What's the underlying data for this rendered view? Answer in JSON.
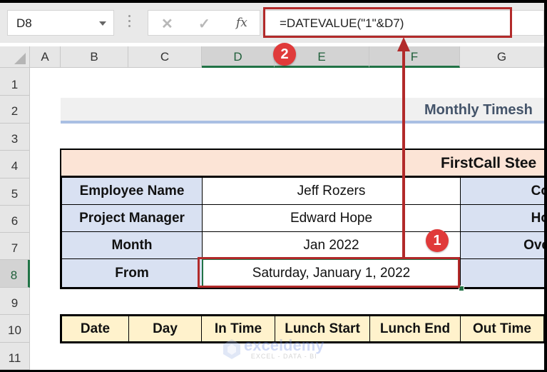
{
  "formula_bar": {
    "name_box": "D8",
    "cancel_icon": "✕",
    "enter_icon": "✓",
    "fx_label": "fx",
    "formula": "=DATEVALUE(\"1\"&D7)"
  },
  "columns": [
    "A",
    "B",
    "C",
    "D",
    "E",
    "F",
    "G"
  ],
  "selected_column": "D",
  "rows": [
    "1",
    "2",
    "3",
    "4",
    "5",
    "6",
    "7",
    "8",
    "9",
    "10",
    "11"
  ],
  "selected_row": "8",
  "sheet": {
    "title": "Monthly Timesh",
    "company": "FirstCall Stee",
    "info": [
      {
        "label": "Employee Name",
        "value": "Jeff Rozers",
        "right_label": "Co"
      },
      {
        "label": "Project Manager",
        "value": "Edward Hope",
        "right_label": "Ho"
      },
      {
        "label": "Month",
        "value": "Jan 2022",
        "right_label": "Ove"
      },
      {
        "label": "From",
        "value": "Saturday, January 1, 2022",
        "right_label": ""
      }
    ],
    "table_headers": [
      "Date",
      "Day",
      "In Time",
      "Lunch Start",
      "Lunch End",
      "Out Time"
    ]
  },
  "annotations": {
    "step1": "1",
    "step2": "2",
    "color": "#b22a2a",
    "badge_color": "#e03a3a"
  },
  "watermark": {
    "name": "exceldemy",
    "tagline": "EXCEL - DATA - BI"
  }
}
